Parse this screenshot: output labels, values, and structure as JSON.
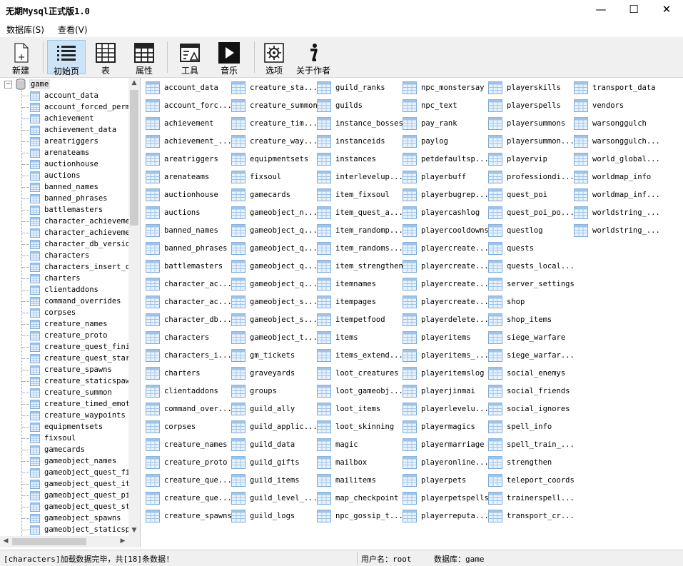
{
  "window": {
    "title": "无期Mysql正式版1.0",
    "minimize": "—",
    "maximize": "☐",
    "close": "✕"
  },
  "menu": [
    "数据库(S)",
    "查看(V)"
  ],
  "toolbar": {
    "new": "新建",
    "home": "初始页",
    "table": "表",
    "props": "属性",
    "tools": "工具",
    "music": "音乐",
    "options": "选项",
    "about": "关于作者"
  },
  "tree": {
    "root": "game",
    "items": [
      "account_data",
      "account_forced_permi",
      "achievement",
      "achievement_data",
      "areatriggers",
      "arenateams",
      "auctionhouse",
      "auctions",
      "banned_names",
      "banned_phrases",
      "battlemasters",
      "character_achievemen",
      "character_achievemen",
      "character_db_version",
      "characters",
      "characters_insert_qu",
      "charters",
      "clientaddons",
      "command_overrides",
      "corpses",
      "creature_names",
      "creature_proto",
      "creature_quest_finis",
      "creature_quest_start",
      "creature_spawns",
      "creature_staticspawn",
      "creature_summon",
      "creature_timed_emote",
      "creature_waypoints",
      "equipmentsets",
      "fixsoul",
      "gamecards",
      "gameobject_names",
      "gameobject_quest_fin",
      "gameobject_quest_ite",
      "gameobject_quest_pic",
      "gameobject_quest_sta",
      "gameobject_spawns",
      "gameobject_staticspa"
    ]
  },
  "tables": [
    [
      "account_data",
      "account_forc...",
      "achievement",
      "achievement_...",
      "areatriggers",
      "arenateams",
      "auctionhouse",
      "auctions",
      "banned_names",
      "banned_phrases",
      "battlemasters",
      "character_ac...",
      "character_ac...",
      "character_db...",
      "characters",
      "characters_i...",
      "charters",
      "clientaddons",
      "command_over...",
      "corpses",
      "creature_names",
      "creature_proto",
      "creature_que...",
      "creature_que...",
      "creature_spawns"
    ],
    [
      "creature_sta...",
      "creature_summon",
      "creature_tim...",
      "creature_way...",
      "equipmentsets",
      "fixsoul",
      "gamecards",
      "gameobject_n...",
      "gameobject_q...",
      "gameobject_q...",
      "gameobject_q...",
      "gameobject_q...",
      "gameobject_s...",
      "gameobject_s...",
      "gameobject_t...",
      "gm_tickets",
      "graveyards",
      "groups",
      "guild_ally",
      "guild_applic...",
      "guild_data",
      "guild_gifts",
      "guild_items",
      "guild_level_...",
      "guild_logs"
    ],
    [
      "guild_ranks",
      "guilds",
      "instance_bosses",
      "instanceids",
      "instances",
      "interlevelup...",
      "item_fixsoul",
      "item_quest_a...",
      "item_randomp...",
      "item_randoms...",
      "item_strengthen",
      "itemnames",
      "itempages",
      "itempetfood",
      "items",
      "items_extend...",
      "loot_creatures",
      "loot_gameobj...",
      "loot_items",
      "loot_skinning",
      "magic",
      "mailbox",
      "mailitems",
      "map_checkpoint",
      "npc_gossip_t..."
    ],
    [
      "npc_monstersay",
      "npc_text",
      "pay_rank",
      "paylog",
      "petdefaultsp...",
      "playerbuff",
      "playerbugrep...",
      "playercashlog",
      "playercooldowns",
      "playercreate...",
      "playercreate...",
      "playercreate...",
      "playercreate...",
      "playerdelete...",
      "playeritems",
      "playeritems_...",
      "playeritemslog",
      "playerjinmai",
      "playerlevelu...",
      "playermagics",
      "playermarriage",
      "playeronline...",
      "playerpets",
      "playerpetspells",
      "playerreputa..."
    ],
    [
      "playerskills",
      "playerspells",
      "playersummons",
      "playersummon...",
      "playervip",
      "professiondi...",
      "quest_poi",
      "quest_poi_po...",
      "questlog",
      "quests",
      "quests_local...",
      "server_settings",
      "shop",
      "shop_items",
      "siege_warfare",
      "siege_warfar...",
      "social_enemys",
      "social_friends",
      "social_ignores",
      "spell_info",
      "spell_train_...",
      "strengthen",
      "teleport_coords",
      "trainerspell...",
      "transport_cr..."
    ],
    [
      "transport_data",
      "vendors",
      "warsonggulch",
      "warsonggulch...",
      "world_global...",
      "worldmap_info",
      "worldmap_inf...",
      "worldstring_...",
      "worldstring_..."
    ]
  ],
  "status": {
    "message": "[characters]加载数据完毕，共[18]条数据!",
    "user": "用户名：root",
    "db": "数据库：game"
  }
}
